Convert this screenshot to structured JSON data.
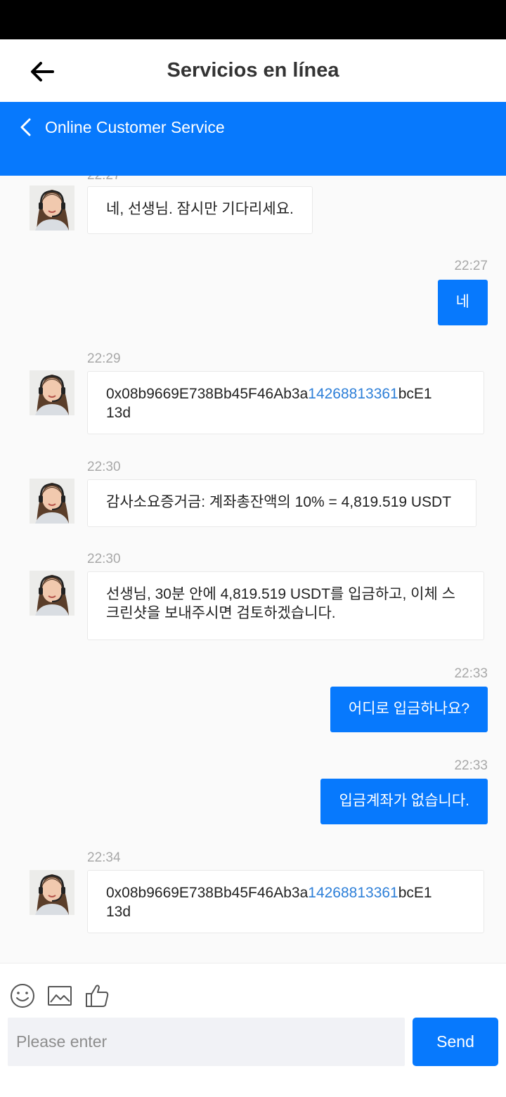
{
  "header": {
    "title": "Servicios en línea"
  },
  "service_bar": {
    "title": "Online Customer Service"
  },
  "messages": [
    {
      "side": "in",
      "time": "22:27",
      "text": "네, 선생님. 잠시만 기다리세요."
    },
    {
      "side": "out",
      "time": "22:27",
      "text": "네"
    },
    {
      "side": "in",
      "time": "22:29",
      "text_a": "0x08b9669E738Bb45F46Ab3a",
      "text_b": "14268813361",
      "text_c": "bcE1",
      "text_d": "13d"
    },
    {
      "side": "in",
      "time": "22:30",
      "text": "감사소요증거금: 계좌총잔액의 10% = 4,819.519 USDT"
    },
    {
      "side": "in",
      "time": "22:30",
      "text_a": "선생님, 30분 안에 4,819.519 USDT를 입금하고, 이체 스",
      "text_b": "크린샷을 보내주시면 검토하겠습니다."
    },
    {
      "side": "out",
      "time": "22:33",
      "text": "어디로 입금하나요?"
    },
    {
      "side": "out",
      "time": "22:33",
      "text": "입금계좌가 없습니다."
    },
    {
      "side": "in",
      "time": "22:34",
      "text_a": "0x08b9669E738Bb45F46Ab3a",
      "text_b": "14268813361",
      "text_c": "bcE1",
      "text_d": "13d"
    }
  ],
  "composer": {
    "placeholder": "Please enter",
    "send_label": "Send"
  },
  "icons": {
    "back": "arrow-left-icon",
    "cs_back": "chevron-left-icon",
    "emoji": "smiley-icon",
    "image": "image-icon",
    "like": "thumbs-up-icon"
  },
  "colors": {
    "accent": "#0779fd",
    "link": "#2d7fd8",
    "time": "#a8a8a8"
  }
}
